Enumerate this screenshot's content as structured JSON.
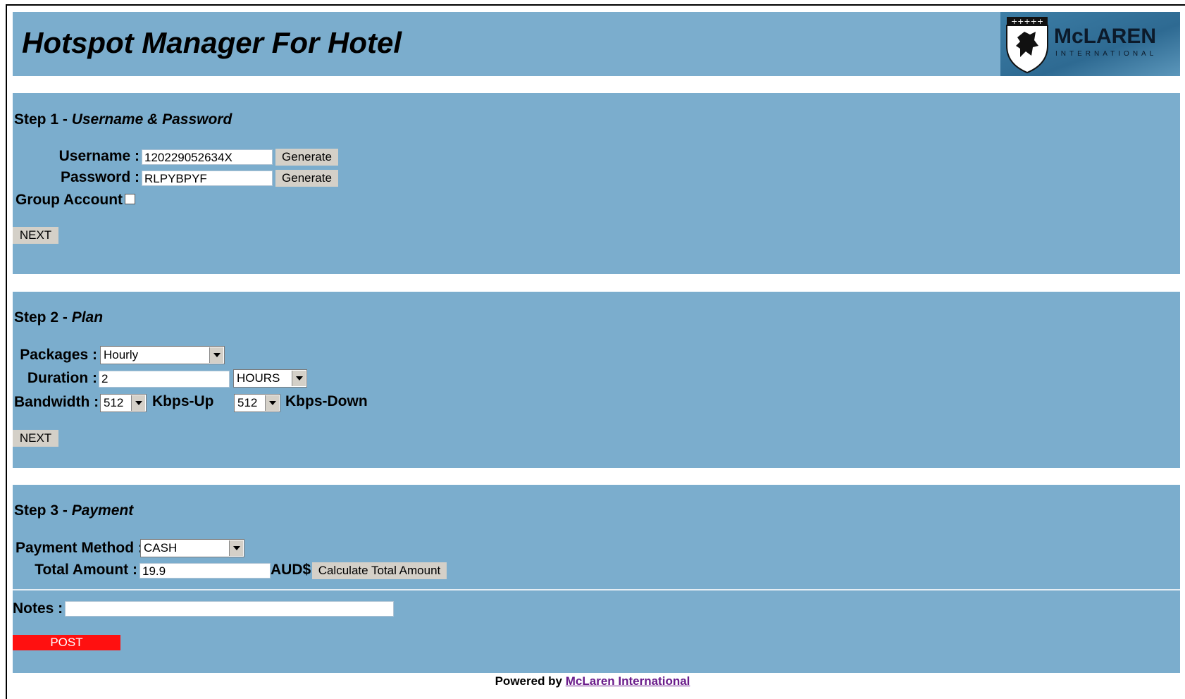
{
  "header": {
    "title": "Hotspot Manager For Hotel",
    "logo_text": "McLAREN",
    "logo_subtext": "INTERNATIONAL",
    "logo_icon": "shield-lion-icon"
  },
  "step1": {
    "heading_prefix": "Step 1 - ",
    "heading_name": "Username & Password",
    "username_label": "Username :",
    "username_value": "120229052634X",
    "password_label": "Password :",
    "password_value": "RLPYBPYF",
    "generate_label": "Generate",
    "group_account_label": "Group Account",
    "group_account_checked": false,
    "next_label": "NEXT"
  },
  "step2": {
    "heading_prefix": "Step 2 - ",
    "heading_name": "Plan",
    "packages_label": "Packages :",
    "packages_value": "Hourly",
    "duration_label": "Duration :",
    "duration_value": "2",
    "duration_unit": "HOURS",
    "bandwidth_label": "Bandwidth :",
    "bandwidth_up_value": "512",
    "bandwidth_up_unit": "Kbps-Up",
    "bandwidth_down_value": "512",
    "bandwidth_down_unit": "Kbps-Down",
    "next_label": "NEXT"
  },
  "step3": {
    "heading_prefix": "Step 3 - ",
    "heading_name": "Payment",
    "payment_method_label": "Payment Method :",
    "payment_method_value": "CASH",
    "total_amount_label": "Total Amount :",
    "total_amount_value": "19.9",
    "currency": "AUD$",
    "calculate_label": "Calculate Total Amount",
    "notes_label": "Notes :",
    "notes_value": "",
    "post_label": "POST"
  },
  "footer": {
    "powered_by": "Powered by",
    "link_text": "McLaren International"
  },
  "colors": {
    "panel": "#7badcd",
    "post_button": "#ff1010",
    "link": "#6a1b8a"
  }
}
